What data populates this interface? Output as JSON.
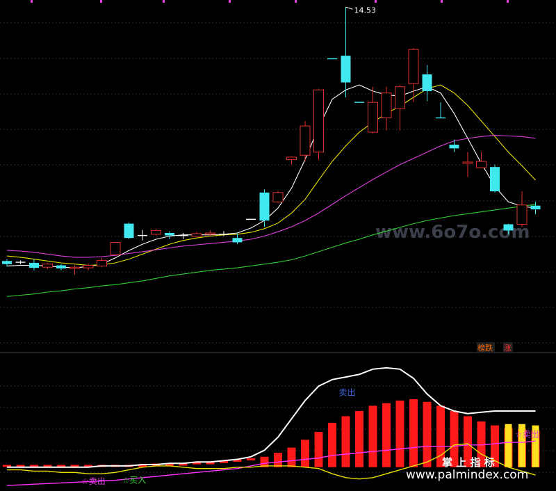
{
  "chart_data": [
    {
      "type": "candlestick",
      "panel": "price",
      "x_count": 40,
      "ylim": [
        9.0,
        14.6
      ],
      "grid": true,
      "high_label": "14.53",
      "watermark": "www.6o7o.com",
      "legend": [
        {
          "text": "榜跌",
          "color": "#FF6A00"
        },
        {
          "text": "涨",
          "color": "#FF3030"
        }
      ],
      "candles": [
        [
          0,
          10.45,
          10.4,
          10.48,
          10.36
        ],
        [
          1,
          10.43,
          10.43,
          10.46,
          10.4
        ],
        [
          2,
          10.42,
          10.34,
          10.48,
          10.3
        ],
        [
          3,
          10.35,
          10.4,
          10.42,
          10.32
        ],
        [
          4,
          10.38,
          10.33,
          10.4,
          10.3
        ],
        [
          5,
          10.33,
          10.35,
          10.38,
          10.23
        ],
        [
          6,
          10.34,
          10.38,
          10.41,
          10.3
        ],
        [
          7,
          10.37,
          10.46,
          10.5,
          10.35
        ],
        [
          8,
          10.55,
          10.75,
          10.76,
          10.54
        ],
        [
          9,
          11.05,
          10.82,
          11.07,
          10.8
        ],
        [
          10,
          10.86,
          10.86,
          10.95,
          10.78
        ],
        [
          11,
          10.88,
          10.94,
          10.97,
          10.86
        ],
        [
          12,
          10.9,
          10.86,
          10.93,
          10.8
        ],
        [
          13,
          10.86,
          10.86,
          10.9,
          10.8
        ],
        [
          14,
          10.85,
          10.89,
          10.92,
          10.84
        ],
        [
          15,
          10.88,
          10.9,
          10.94,
          10.85
        ],
        [
          16,
          10.88,
          10.88,
          10.93,
          10.85
        ],
        [
          17,
          10.82,
          10.75,
          10.9,
          10.72
        ],
        [
          18,
          11.12,
          11.12,
          11.12,
          11.12
        ],
        [
          19,
          11.55,
          11.1,
          11.6,
          11.0
        ],
        [
          20,
          11.4,
          11.55,
          11.58,
          11.38
        ],
        [
          21,
          12.08,
          12.12,
          12.13,
          12.0
        ],
        [
          22,
          12.15,
          12.62,
          12.7,
          12.05
        ],
        [
          23,
          12.2,
          13.2,
          13.22,
          12.08
        ],
        [
          24,
          13.7,
          13.7,
          13.7,
          13.7
        ],
        [
          25,
          13.75,
          13.32,
          14.53,
          13.08
        ],
        [
          26,
          13.0,
          13.0,
          13.0,
          13.0
        ],
        [
          27,
          12.52,
          13.0,
          13.25,
          12.5
        ],
        [
          28,
          12.75,
          13.15,
          13.25,
          12.55
        ],
        [
          29,
          12.9,
          13.25,
          13.28,
          12.55
        ],
        [
          30,
          13.3,
          13.85,
          13.87,
          13.0
        ],
        [
          31,
          13.45,
          13.18,
          13.6,
          13.02
        ],
        [
          32,
          12.75,
          12.75,
          13.0,
          12.75
        ],
        [
          33,
          12.32,
          12.26,
          12.4,
          12.2
        ],
        [
          34,
          12.02,
          12.04,
          12.2,
          11.8
        ],
        [
          35,
          11.95,
          12.05,
          12.2,
          11.95
        ],
        [
          36,
          11.96,
          11.57,
          12.0,
          11.55
        ],
        [
          37,
          11.04,
          10.94,
          11.05,
          10.88
        ],
        [
          38,
          11.04,
          11.35,
          11.57,
          11.0
        ],
        [
          39,
          11.34,
          11.28,
          11.4,
          11.2
        ]
      ],
      "series": [
        {
          "color": "#FFFFFF",
          "values": [
            10.37,
            10.38,
            10.38,
            10.37,
            10.35,
            10.34,
            10.36,
            10.4,
            10.5,
            10.62,
            10.72,
            10.8,
            10.85,
            10.87,
            10.87,
            10.87,
            10.88,
            10.9,
            10.98,
            11.1,
            11.3,
            11.62,
            12.08,
            12.6,
            13.05,
            13.2,
            13.28,
            13.18,
            13.12,
            13.1,
            13.18,
            13.25,
            13.15,
            12.82,
            12.42,
            12.02,
            11.65,
            11.4,
            11.33,
            11.3
          ]
        },
        {
          "color": "#E8E000",
          "values": [
            10.53,
            10.51,
            10.48,
            10.45,
            10.42,
            10.4,
            10.38,
            10.39,
            10.42,
            10.48,
            10.56,
            10.64,
            10.72,
            10.78,
            10.82,
            10.85,
            10.87,
            10.88,
            10.91,
            10.97,
            11.06,
            11.22,
            11.44,
            11.75,
            12.05,
            12.3,
            12.52,
            12.68,
            12.82,
            12.94,
            13.08,
            13.22,
            13.28,
            13.15,
            12.95,
            12.7,
            12.45,
            12.2,
            11.98,
            11.75
          ]
        },
        {
          "color": "#E040E0",
          "values": [
            10.62,
            10.61,
            10.59,
            10.56,
            10.53,
            10.51,
            10.51,
            10.52,
            10.54,
            10.57,
            10.6,
            10.63,
            10.66,
            10.69,
            10.71,
            10.73,
            10.75,
            10.77,
            10.8,
            10.85,
            10.92,
            11.0,
            11.1,
            11.22,
            11.36,
            11.5,
            11.63,
            11.76,
            11.88,
            12.0,
            12.1,
            12.2,
            12.3,
            12.38,
            12.42,
            12.45,
            12.47,
            12.46,
            12.45,
            12.42
          ]
        },
        {
          "color": "#30D030",
          "values": [
            9.88,
            9.9,
            9.92,
            9.95,
            9.97,
            10.0,
            10.02,
            10.05,
            10.07,
            10.1,
            10.13,
            10.17,
            10.21,
            10.24,
            10.27,
            10.3,
            10.32,
            10.34,
            10.37,
            10.4,
            10.43,
            10.47,
            10.53,
            10.6,
            10.67,
            10.74,
            10.8,
            10.87,
            10.93,
            10.99,
            11.05,
            11.1,
            11.14,
            11.18,
            11.21,
            11.24,
            11.27,
            11.3,
            11.33,
            11.36
          ]
        }
      ]
    },
    {
      "type": "bar",
      "panel": "indicator",
      "x_count": 40,
      "ylim": [
        0,
        100
      ],
      "grid": true,
      "bars": [
        {
          "color": "#FF1A1A",
          "values": [
            16,
            16,
            16,
            16,
            16,
            16,
            16,
            16,
            16,
            16,
            16,
            17,
            17,
            17,
            18,
            18,
            19,
            20,
            21,
            23,
            26,
            30,
            36,
            42,
            49,
            54,
            58,
            62,
            64,
            66,
            67,
            65,
            62,
            58,
            54,
            50,
            47,
            45,
            44,
            43
          ]
        },
        {
          "color": "#FFE020",
          "values": [
            null,
            null,
            null,
            null,
            null,
            null,
            null,
            null,
            null,
            null,
            null,
            null,
            null,
            null,
            null,
            null,
            null,
            null,
            null,
            null,
            null,
            null,
            null,
            null,
            null,
            null,
            null,
            null,
            null,
            null,
            null,
            null,
            null,
            null,
            null,
            null,
            null,
            48,
            48,
            47
          ]
        }
      ],
      "series": [
        {
          "color": "#FFFFFF",
          "values": [
            15,
            15,
            15,
            15,
            15,
            15,
            15,
            16,
            16,
            16,
            17,
            17,
            18,
            18,
            19,
            19,
            20,
            21,
            23,
            28,
            38,
            52,
            66,
            77,
            82,
            84,
            86,
            90,
            91,
            90,
            83,
            71,
            62,
            58,
            56,
            57,
            58,
            58,
            58,
            58
          ]
        },
        {
          "color": "#FF30FF",
          "values": [
            1,
            1.5,
            2,
            2.5,
            3,
            3.5,
            4,
            4.5,
            5,
            6,
            7,
            8,
            9,
            10,
            11,
            12,
            13,
            14,
            16,
            18,
            19,
            20,
            21,
            22,
            24,
            25,
            26,
            27,
            28,
            29,
            30,
            31,
            31,
            31,
            32,
            32,
            33,
            34,
            34,
            35
          ]
        },
        {
          "color": "#E8E000",
          "values": [
            13,
            13,
            12,
            12,
            11,
            11,
            10,
            10,
            11,
            13,
            15,
            16,
            16,
            15,
            14,
            14,
            14,
            15,
            15,
            16,
            16,
            16,
            15,
            14,
            10,
            7,
            6,
            7,
            10,
            13,
            16,
            19,
            24,
            32,
            33,
            25,
            20,
            15,
            12,
            9
          ]
        }
      ],
      "annotations": [
        {
          "text": "卖出",
          "x": 25,
          "y": 70,
          "color": "#4169E1"
        },
        {
          "text": "☆卖出",
          "x": 6,
          "y": 2,
          "color": "#E040E0"
        },
        {
          "text": "☆买入",
          "x": 9,
          "y": 3,
          "color": "#30D030"
        },
        {
          "text": "☆卖出",
          "x": 38,
          "y": 38,
          "color": "#E040E0"
        }
      ],
      "watermarks": [
        {
          "text": "掌 上 指 标",
          "x": 35,
          "y": 13
        },
        {
          "text": "www.palmindex.com",
          "x": 33,
          "y": 1
        }
      ]
    }
  ]
}
